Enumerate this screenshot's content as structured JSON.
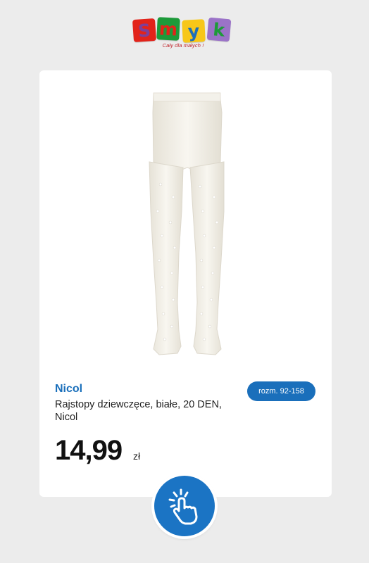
{
  "logo": {
    "letters": [
      "S",
      "m",
      "y",
      "k"
    ],
    "tile_colors": [
      "#e2231a",
      "#1d9a3a",
      "#f7c719",
      "#9b73c8"
    ],
    "letter_colors": [
      "#7e3f98",
      "#e2231a",
      "#1d6fb8",
      "#1d9a3a"
    ],
    "tagline": "Cały dla małych !"
  },
  "product": {
    "image_icon": "tights-image",
    "brand": "Nicol",
    "size_label": "rozm. 92-158",
    "title": "Rajstopy dziewczęce, białe, 20 DEN, Nicol",
    "price": "14,99",
    "currency": "zł"
  },
  "action": {
    "icon": "tap-hand-icon"
  },
  "colors": {
    "accent": "#1a6fbb",
    "background": "#ececec",
    "card": "#ffffff"
  }
}
